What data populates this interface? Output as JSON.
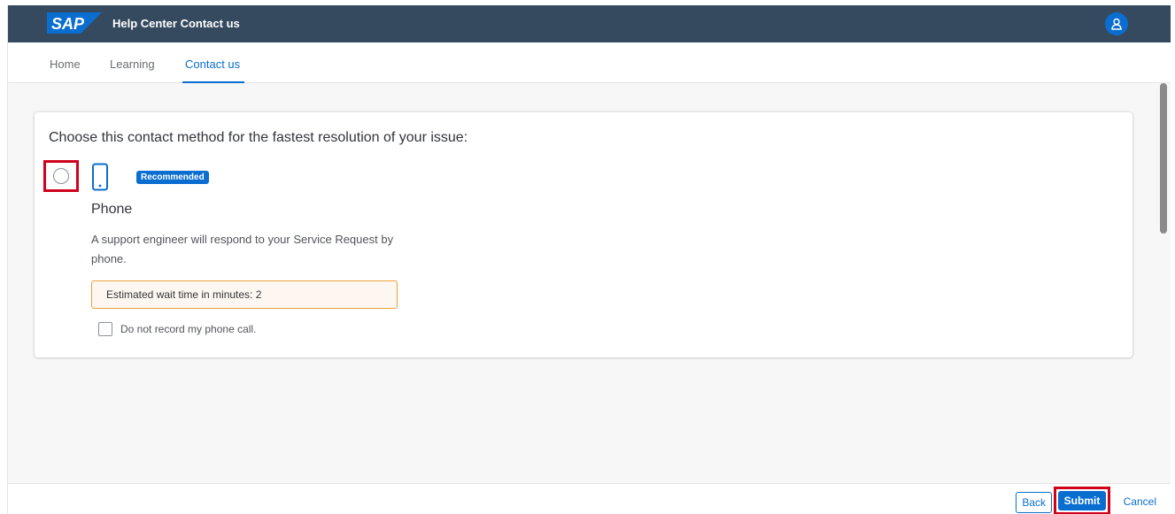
{
  "shellbar": {
    "logo_text": "SAP",
    "title": "Help Center Contact us",
    "avatar_icon": "person-icon"
  },
  "nav": {
    "tabs": [
      {
        "label": "Home",
        "active": false
      },
      {
        "label": "Learning",
        "active": false
      },
      {
        "label": "Contact us",
        "active": true
      }
    ]
  },
  "card": {
    "heading": "Choose this contact method for the fastest resolution of your issue:",
    "option": {
      "selected": false,
      "icon": "phone-icon",
      "badge": "Recommended",
      "title": "Phone",
      "description": "A support engineer will respond to your Service Request by phone.",
      "wait_time_text": "Estimated wait time in minutes: 2",
      "checkbox_label": "Do not record my phone call.",
      "checkbox_checked": false
    }
  },
  "footer": {
    "back_label": "Back",
    "submit_label": "Submit",
    "cancel_label": "Cancel"
  },
  "colors": {
    "shellbar": "#354a5f",
    "accent": "#0a6ed1",
    "highlight": "#d0021b",
    "warning_border": "#e9a03b"
  }
}
